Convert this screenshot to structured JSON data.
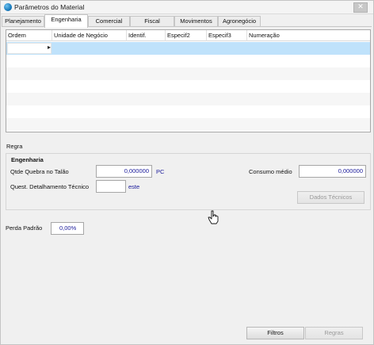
{
  "window": {
    "title": "Parâmetros do Material",
    "close_glyph": "✕"
  },
  "tabs": [
    {
      "label": "Planejamento"
    },
    {
      "label": "Engenharia"
    },
    {
      "label": "Comercial"
    },
    {
      "label": "Fiscal"
    },
    {
      "label": "Movimentos"
    },
    {
      "label": "Agronegócio"
    }
  ],
  "active_tab": "Engenharia",
  "grid": {
    "columns": [
      "Ordem",
      "Unidade de Negócio",
      "Identif.",
      "Especif2",
      "Especif3",
      "Numeração"
    ],
    "row_indicator": "▸",
    "rows": []
  },
  "regra": {
    "label": "Regra",
    "group_title": "Engenharia",
    "qtde_quebra_label": "Qtde Quebra no Talão",
    "qtde_quebra_value": "0,000000",
    "qtde_quebra_unit": "PC",
    "quest_label": "Quest. Detalhamento Técnico",
    "quest_value": "",
    "quest_unit": "este",
    "consumo_label": "Consumo médio",
    "consumo_value": "0,000000",
    "dados_tecnicos_button": "Dados Técnicos"
  },
  "perda": {
    "label": "Perda Padrão",
    "value": "0,00%"
  },
  "footer": {
    "filtros_button": "Filtros",
    "regras_button": "Regras"
  },
  "colors": {
    "selected_row": "#bfe2fb",
    "value_text": "#1a1a9a"
  }
}
